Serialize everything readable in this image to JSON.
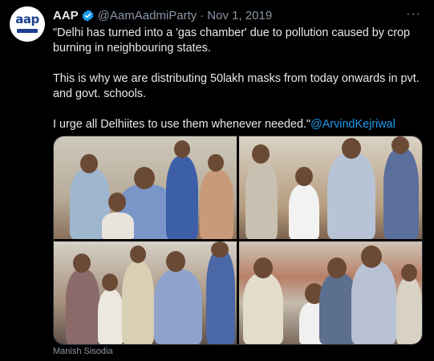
{
  "tweet": {
    "avatar_text": "aap",
    "display_name": "AAP",
    "handle": "@AamAadmiParty",
    "separator": "·",
    "date": "Nov 1, 2019",
    "more_label": "···",
    "paragraph_1": "\"Delhi has turned into a 'gas chamber' due to pollution caused by crop burning in neighbouring states.",
    "paragraph_2": "This is why we are distributing 50lakh masks from today onwards in pvt. and govt. schools.",
    "paragraph_3": "I urge all Delhiites to use them whenever needed.\"",
    "mention": "@ArvindKejriwal",
    "media_caption": "Manish Sisodia"
  },
  "colors": {
    "background": "#000000",
    "text": "#e7e9ea",
    "muted": "#8b98a5",
    "link": "#1d9bf0",
    "verified": "#1d9bf0",
    "brand": "#1d3f8f"
  },
  "icons": {
    "verified": "verified-badge-icon",
    "more": "more-options-icon"
  }
}
